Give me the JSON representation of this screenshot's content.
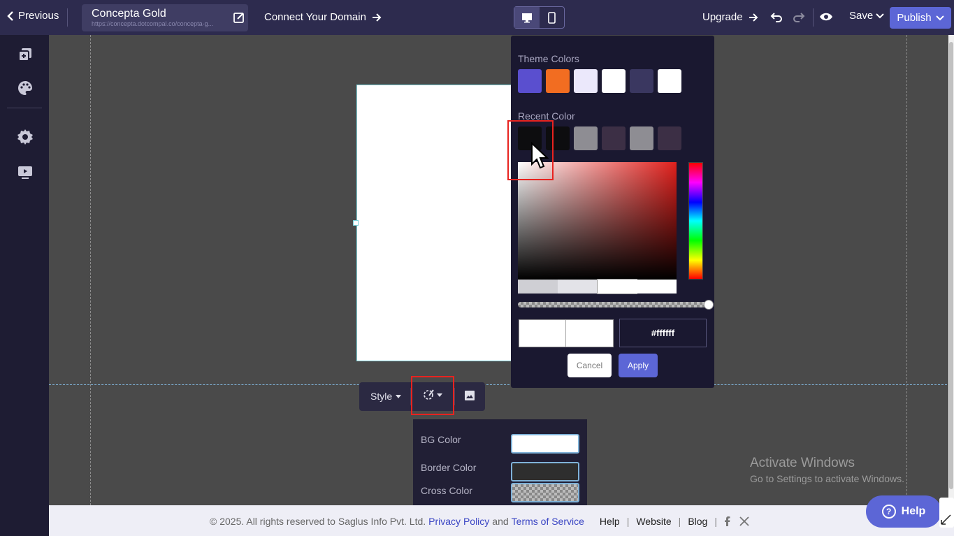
{
  "topbar": {
    "previous_label": "Previous",
    "site_name": "Concepta Gold",
    "site_url": "https://concepta.dotcompal.co/concepta-g...",
    "connect_label": "Connect Your Domain",
    "upgrade_label": "Upgrade",
    "save_label": "Save",
    "publish_label": "Publish"
  },
  "sidebar": {
    "items": [
      {
        "icon": "pages-icon"
      },
      {
        "icon": "palette-icon"
      },
      {
        "icon": "gear-icon"
      },
      {
        "icon": "preview-icon"
      }
    ]
  },
  "toolbar": {
    "style_label": "Style"
  },
  "style_popover": {
    "bg_color_label": "BG Color",
    "border_color_label": "Border Color",
    "cross_color_label": "Cross Color",
    "bg_color_value": "#ffffff",
    "border_color_value": "#2e2e2e"
  },
  "color_picker": {
    "theme_title": "Theme Colors",
    "theme_colors": [
      "#5a4fcf",
      "#f26d21",
      "#ebe8fb",
      "#ffffff",
      "#3a3760",
      "#ffffff"
    ],
    "recent_title": "Recent Color",
    "recent_colors": [
      "#0d0d0f",
      "#0d0d0f",
      "#8e8d93",
      "#3c2f45",
      "#8e8d93",
      "#3c2f45"
    ],
    "hex_value": "#ffffff",
    "cancel_label": "Cancel",
    "apply_label": "Apply"
  },
  "watermark": {
    "line1": "Activate Windows",
    "line2": "Go to Settings to activate Windows."
  },
  "footer": {
    "copyright": "©  2025. All rights reserved to Saglus Info Pvt. Ltd.",
    "privacy": "Privacy Policy",
    "and": "and",
    "terms": "Terms of Service",
    "help": "Help",
    "website": "Website",
    "blog": "Blog"
  },
  "help_button": {
    "label": "Help"
  },
  "colors": {
    "accent": "#5c66d6",
    "topbar": "#2d2b4e",
    "sidebar": "#1e1c33",
    "highlight": "#e8231f"
  }
}
